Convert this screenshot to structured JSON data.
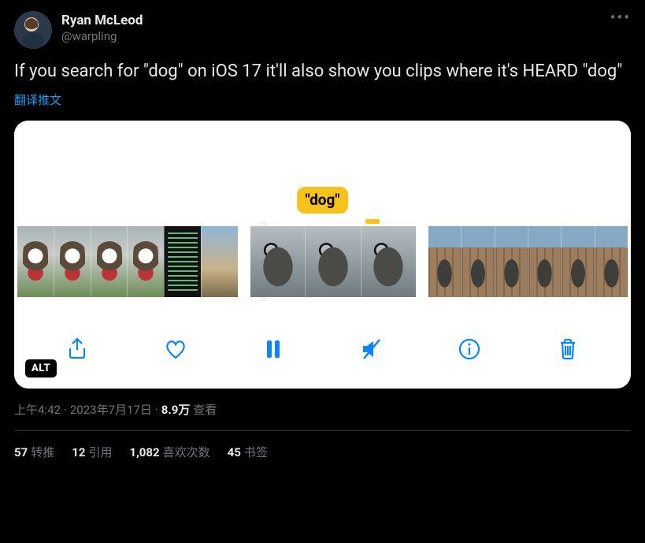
{
  "author": {
    "display_name": "Ryan McLeod",
    "handle": "@warpling"
  },
  "tweet_text": "If you search for \"dog\" on iOS 17 it'll also show you clips where it's HEARD \"dog\"",
  "translate_label": "翻译推文",
  "media": {
    "search_term_pill": "\"dog\"",
    "alt_badge": "ALT",
    "controls": {
      "share": "share",
      "like": "like",
      "pause": "pause",
      "mute": "mute",
      "info": "info",
      "trash": "trash"
    }
  },
  "meta": {
    "time": "上午4:42",
    "date": "2023年7月17日",
    "views_number": "8.9万",
    "views_label": "查看"
  },
  "stats": {
    "retweets_num": "57",
    "retweets_label": "转推",
    "quotes_num": "12",
    "quotes_label": "引用",
    "likes_num": "1,082",
    "likes_label": "喜欢次数",
    "bookmarks_num": "45",
    "bookmarks_label": "书签"
  }
}
